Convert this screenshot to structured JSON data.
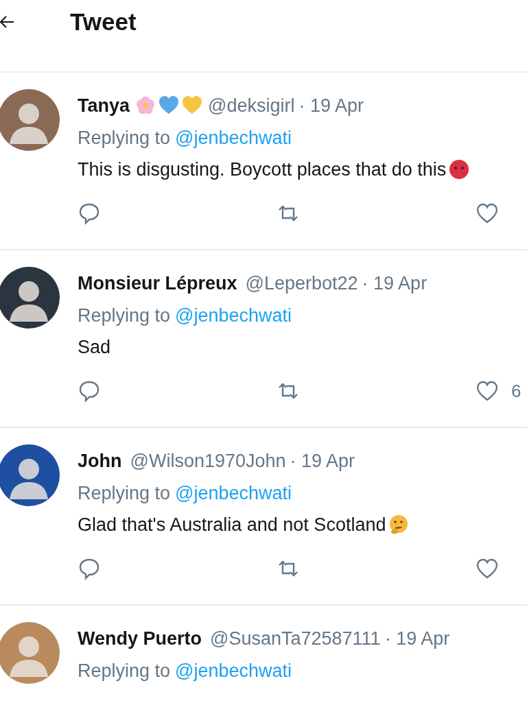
{
  "header": {
    "title": "Tweet"
  },
  "replies": [
    {
      "name": "Tanya",
      "name_emoji": [
        {
          "kind": "flower"
        },
        {
          "kind": "heart",
          "color": "#5aa7e8"
        },
        {
          "kind": "heart",
          "color": "#f5c542"
        }
      ],
      "handle": "@deksigirl",
      "date": "· 19 Apr",
      "replying_label": "Replying to",
      "replying_to": "@jenbechwati",
      "text": "This is disgusting. Boycott places that do this",
      "text_emoji": {
        "kind": "angry"
      },
      "color": "#8a6a55"
    },
    {
      "name": "Monsieur Lépreux",
      "handle": "@Leperbot22",
      "date": "· 19 Apr",
      "replying_label": "Replying to",
      "replying_to": "@jenbechwati",
      "text": "Sad",
      "color": "#2b3540",
      "like_count": "6"
    },
    {
      "name": "John",
      "handle": "@Wilson1970John",
      "date": "· 19 Apr",
      "replying_label": "Replying to",
      "replying_to": "@jenbechwati",
      "text": "Glad that's Australia and not Scotland",
      "text_emoji": {
        "kind": "thinking"
      },
      "color": "#1f4fa0"
    },
    {
      "name": "Wendy Puerto",
      "handle": "@SusanTa72587111",
      "date": "· 19 Apr",
      "replying_label": "Replying to",
      "replying_to": "@jenbechwati",
      "color": "#b98a5e"
    }
  ]
}
